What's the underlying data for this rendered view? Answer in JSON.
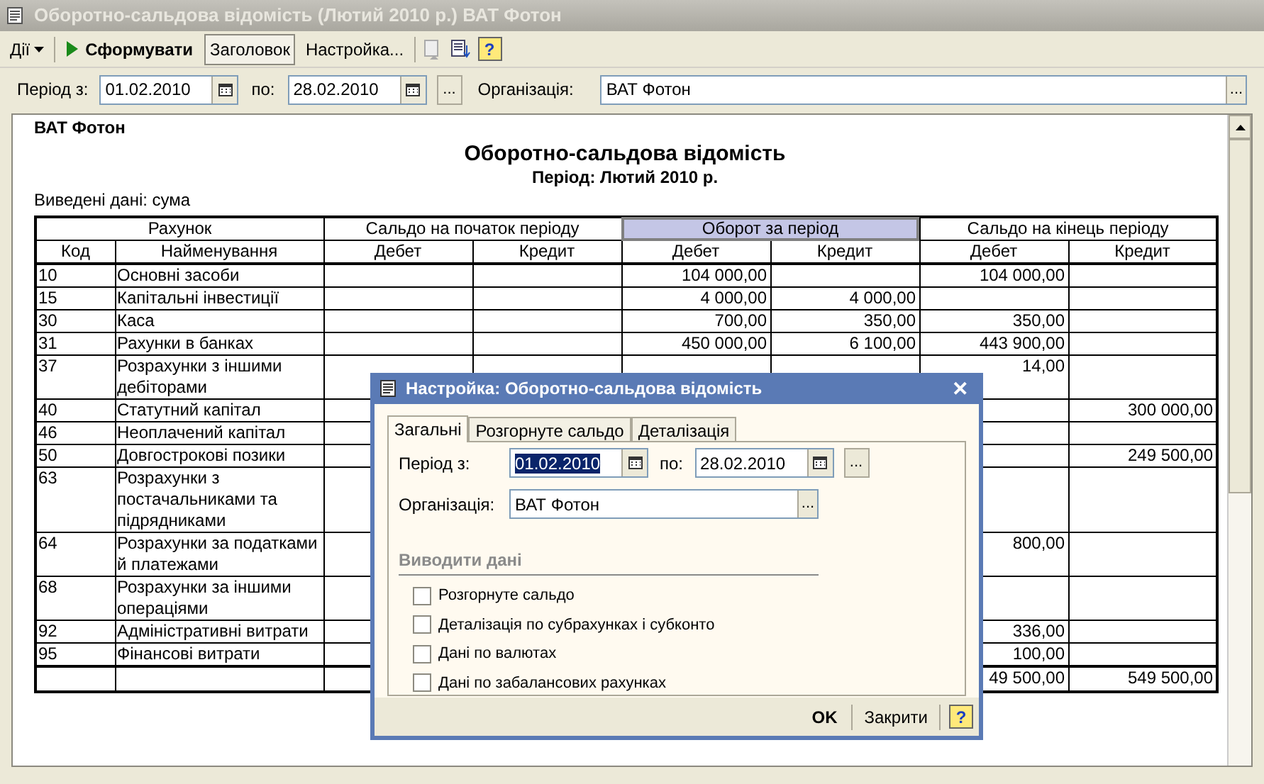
{
  "window": {
    "title": "Оборотно-сальдова відомість (Лютий 2010 р.) ВАТ Фотон"
  },
  "toolbar": {
    "actions_menu": "Дії",
    "generate": "Сформувати",
    "header": "Заголовок",
    "settings": "Настройка...",
    "help": "?"
  },
  "filter": {
    "period_from_label": "Період з:",
    "period_from": "01.02.2010",
    "period_to_label": "по:",
    "period_to": "28.02.2010",
    "more": "...",
    "org_label": "Організація:",
    "org": "ВАТ Фотон",
    "org_more": "..."
  },
  "report": {
    "company": "ВАТ Фотон",
    "title": "Оборотно-сальдова відомість",
    "period": "Період: Лютий 2010 р.",
    "shown": "Виведені дані: сума",
    "groups": [
      {
        "label": "Рахунок",
        "selected": false
      },
      {
        "label": "Сальдо на початок періоду",
        "selected": false
      },
      {
        "label": "Оборот за період",
        "selected": true
      },
      {
        "label": "Сальдо на кінець періоду",
        "selected": false
      }
    ],
    "columns": [
      "Код",
      "Найменування",
      "Дебет",
      "Кредит",
      "Дебет",
      "Кредит",
      "Дебет",
      "Кредит"
    ],
    "rows": [
      {
        "cells": [
          "10",
          "Основні засоби",
          "",
          "",
          "104 000,00",
          "",
          "104 000,00",
          ""
        ]
      },
      {
        "cells": [
          "15",
          "Капітальні інвестиції",
          "",
          "",
          "4 000,00",
          "4 000,00",
          "",
          ""
        ]
      },
      {
        "cells": [
          "30",
          "Каса",
          "",
          "",
          "700,00",
          "350,00",
          "350,00",
          ""
        ]
      },
      {
        "cells": [
          "31",
          "Рахунки в банках",
          "",
          "",
          "450 000,00",
          "6 100,00",
          "443 900,00",
          ""
        ]
      },
      {
        "cells": [
          "37",
          "Розрахунки з іншими дебіторами",
          "",
          "",
          "",
          "",
          "14,00",
          ""
        ]
      },
      {
        "cells": [
          "40",
          "Статутний капітал",
          "",
          "",
          "",
          "",
          "",
          "300 000,00"
        ]
      },
      {
        "cells": [
          "46",
          "Неоплачений капітал",
          "",
          "",
          "",
          "",
          "",
          ""
        ]
      },
      {
        "cells": [
          "50",
          "Довгострокові позики",
          "",
          "",
          "",
          "",
          "",
          "249 500,00"
        ]
      },
      {
        "cells": [
          "63",
          "Розрахунки з постачальниками та підрядниками",
          "",
          "",
          "",
          "",
          "",
          ""
        ]
      },
      {
        "cells": [
          "64",
          "Розрахунки за податками й платежами",
          "",
          "",
          "",
          "",
          "800,00",
          ""
        ]
      },
      {
        "cells": [
          "68",
          "Розрахунки за іншими операціями",
          "",
          "",
          "",
          "",
          "",
          ""
        ]
      },
      {
        "cells": [
          "92",
          "Адміністративні витрати",
          "",
          "",
          "",
          "",
          "336,00",
          ""
        ]
      },
      {
        "cells": [
          "95",
          "Фінансові витрати",
          "",
          "",
          "",
          "",
          "100,00",
          ""
        ]
      },
      {
        "kind": "total",
        "cells": [
          "",
          "",
          "",
          "",
          "",
          "",
          "49 500,00",
          "549 500,00"
        ]
      }
    ]
  },
  "dialog": {
    "title": "Настройка: Оборотно-сальдова відомість",
    "close": "✕",
    "tabs": [
      {
        "label": "Загальні",
        "selected": true
      },
      {
        "label": "Розгорнуте сальдо",
        "selected": false
      },
      {
        "label": "Деталізація",
        "selected": false
      }
    ],
    "period_from_label": "Період з:",
    "period_from": "01.02.2010",
    "period_to_label": "по:",
    "period_to": "28.02.2010",
    "more": "...",
    "org_label": "Організація:",
    "org": "ВАТ Фотон",
    "org_more": "...",
    "section": "Виводити дані",
    "options": [
      {
        "label": "Розгорнуте сальдо",
        "checked": false
      },
      {
        "label": "Деталізація по субрахунках і субконто",
        "checked": false
      },
      {
        "label": "Дані по валютах",
        "checked": false
      },
      {
        "label": "Дані по забалансових рахунках",
        "checked": false
      }
    ],
    "ok": "OK",
    "cancel": "Закрити",
    "help": "?"
  }
}
